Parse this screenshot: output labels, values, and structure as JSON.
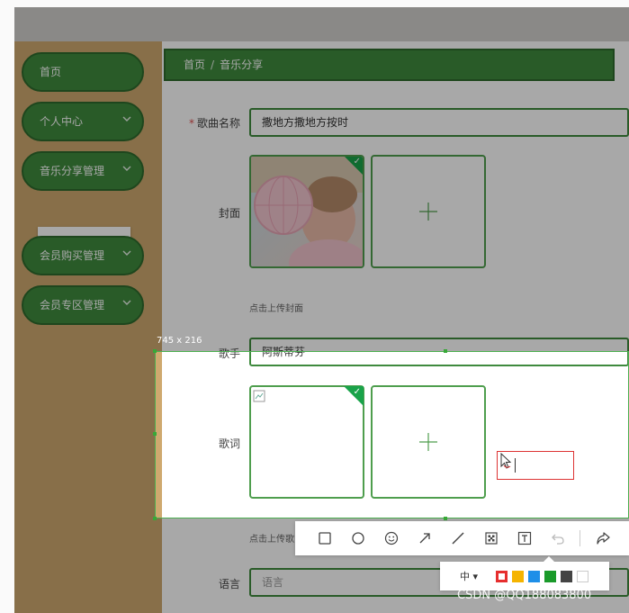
{
  "sidebar": {
    "items": [
      {
        "label": "首页",
        "chevron": false
      },
      {
        "label": "个人中心",
        "chevron": true
      },
      {
        "label": "音乐分享管理",
        "chevron": true
      },
      {
        "label": "会员购买管理",
        "chevron": true
      },
      {
        "label": "会员专区管理",
        "chevron": true
      }
    ],
    "submenu_label": "音乐分享"
  },
  "breadcrumb": {
    "home": "首页",
    "separator": "/",
    "current": "音乐分享"
  },
  "form": {
    "required_mark": "*",
    "song_name_label": "歌曲名称",
    "song_name_value": "撒地方撒地方按时",
    "cover_label": "封面",
    "cover_hint": "点击上传封面",
    "singer_label": "歌手",
    "singer_value": "阿斯蒂芬",
    "lyrics_label": "歌词",
    "lyrics_hint": "点击上传歌",
    "language_label": "语言",
    "language_placeholder": "语言"
  },
  "screenshot_tool": {
    "size_label": "745 x 216",
    "text_tool_value": "",
    "tools": [
      "rectangle-icon",
      "ellipse-icon",
      "emoji-icon",
      "arrow-icon",
      "line-icon",
      "mosaic-icon",
      "text-icon",
      "undo-icon",
      "share-icon"
    ],
    "font_size_label": "中 ▾",
    "colors": [
      "#e62e2e",
      "#f5b400",
      "#1e8fe8",
      "#1a9a2a",
      "#444444",
      "#ffffff"
    ]
  },
  "watermark": "CSDN @QQ188083800",
  "colors": {
    "accent": "#3f8a3e",
    "sidebar": "#cfa96f",
    "submenu_text": "#4f9e4e"
  }
}
